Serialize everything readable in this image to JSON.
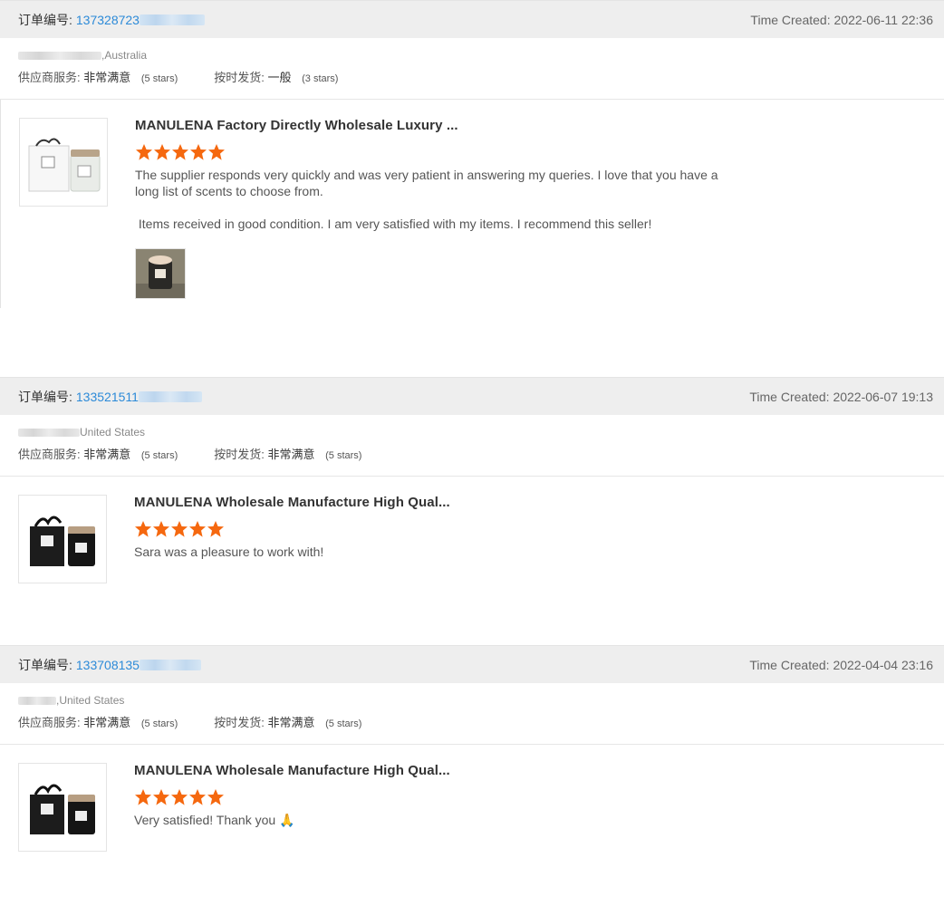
{
  "labels": {
    "order_no": "订单编号:",
    "time_created": "Time Created:",
    "supplier_service": "供应商服务:",
    "on_time_delivery": "按时发货:"
  },
  "reviews": [
    {
      "order_number": "137328723",
      "time": "2022-06-11 22:36",
      "country": ",Australia",
      "supplier_rating": "非常满意",
      "supplier_stars": "(5 stars)",
      "delivery_rating": "一般",
      "delivery_stars": "(3 stars)",
      "product_title": "MANULENA Factory Directly Wholesale Luxury ...",
      "rating": 5,
      "text_1": "The supplier responds very quickly and was very patient in answering my queries. I love that you have a long list of scents to choose from.",
      "text_2": " Items received in good condition. I am very satisfied with my items. I recommend this seller!",
      "has_photo": true
    },
    {
      "order_number": "133521511",
      "time": "2022-06-07 19:13",
      "country": "United States",
      "supplier_rating": "非常满意",
      "supplier_stars": "(5 stars)",
      "delivery_rating": "非常满意",
      "delivery_stars": "(5 stars)",
      "product_title": "MANULENA Wholesale Manufacture High Qual...",
      "rating": 5,
      "text_1": "Sara was a pleasure to work with!"
    },
    {
      "order_number": "133708135",
      "time": "2022-04-04 23:16",
      "country": ",United States",
      "supplier_rating": "非常满意",
      "supplier_stars": "(5 stars)",
      "delivery_rating": "非常满意",
      "delivery_stars": "(5 stars)",
      "product_title": "MANULENA Wholesale Manufacture High Qual...",
      "rating": 5,
      "text_1": "Very satisfied! Thank you 🙏"
    }
  ],
  "colors": {
    "star": "#f5680f",
    "order_link": "#2c8ad8",
    "header_bg": "#eeeeee"
  },
  "icons": {
    "star": "star-icon",
    "product_white": "white-candle-set-image",
    "product_black": "black-candle-gift-box-image",
    "review_photo": "candle-jar-photo"
  }
}
